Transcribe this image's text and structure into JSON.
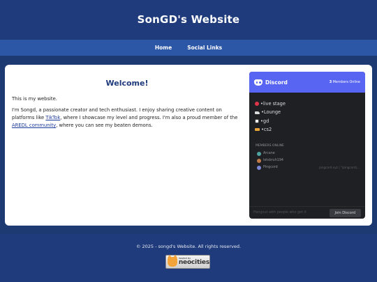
{
  "header": {
    "title": "SonGD's Website"
  },
  "nav": {
    "items": [
      "Home",
      "Social Links"
    ]
  },
  "main": {
    "heading": "Welcome!",
    "intro": "This is my website.",
    "body_part1": "I'm Songd, a passionate creator and tech enthusiast. I enjoy sharing creative content on platforms like ",
    "tiktok_link": "TikTok",
    "body_part2": ", where I showcase my level and progress. I'm also a proud member of the ",
    "aredl_link": "AREDL community",
    "body_part3": ", where you can see my beaten demons."
  },
  "discord": {
    "brand": "Discord",
    "members_count": "3",
    "members_label": "Members Online",
    "channels": [
      "•live stage",
      "•Lounge",
      "•gd",
      "•cs2"
    ],
    "members_title": "MEMBERS ONLINE",
    "members": [
      {
        "name": "Arcane",
        "game": ""
      },
      {
        "name": "letsbruh194",
        "game": ""
      },
      {
        "name": "Pingcord",
        "game": "pingcord.xyz | \"/pingcord|..."
      }
    ],
    "footer_text": "Hangout with people who get it",
    "join_label": "Join Discord"
  },
  "footer": {
    "copyright": "© 2025 - songd's Website. All rights reserved.",
    "badge_small": "hosted by",
    "badge_big": "neocities"
  },
  "colors": {
    "background": "#1e3a72",
    "nav": "#2c57a6",
    "heading": "#1f3b7c",
    "discord_blurple": "#5865f2"
  }
}
